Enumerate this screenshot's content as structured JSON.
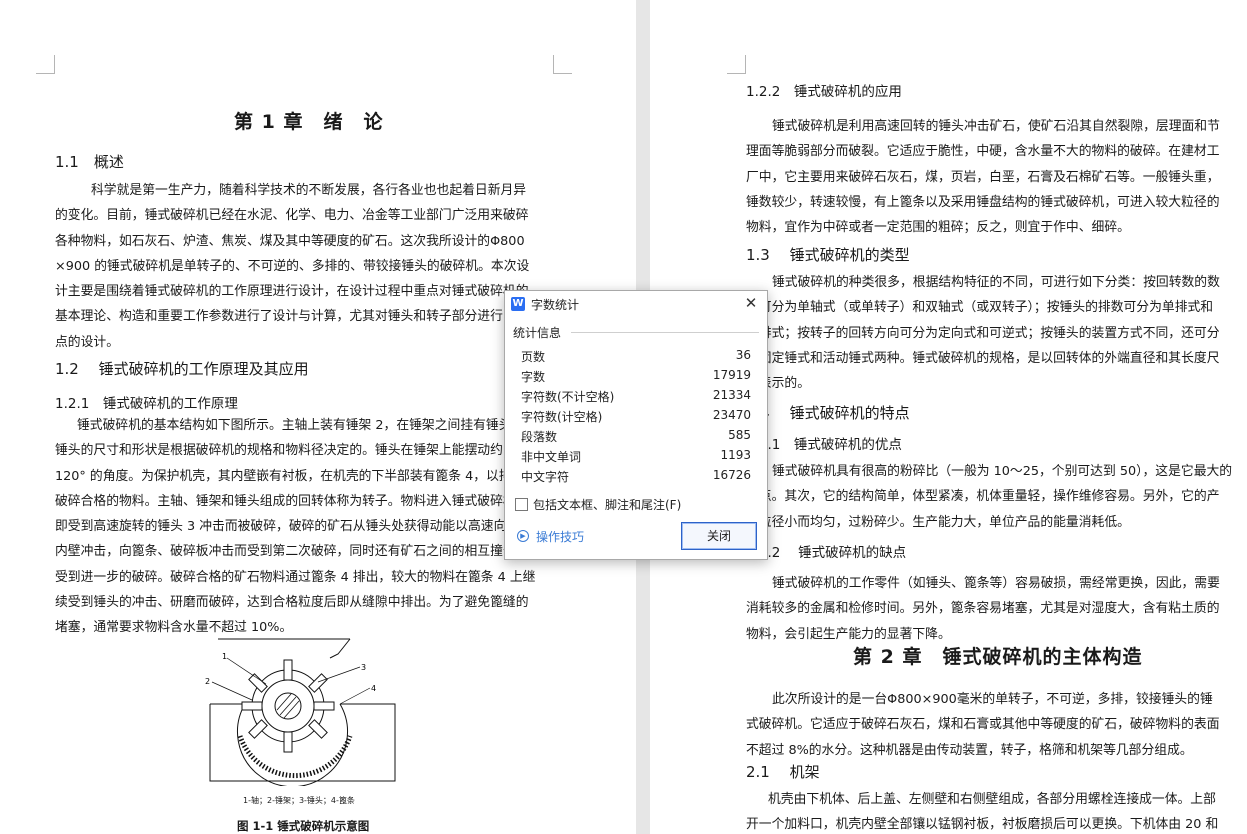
{
  "left_page": {
    "chapter_title": "第 1 章　绪　论",
    "s1_1": "1.1　概述",
    "p1": [
      "科学就是第一生产力，随着科学技术的不断发展，各行各业也也起着日新月异",
      "的变化。目前，锤式破碎机已经在水泥、化学、电力、冶金等工业部门广泛用来破碎",
      "各种物料，如石灰石、炉渣、焦炭、煤及其中等硬度的矿石。这次我所设计的Φ800",
      "×900 的锤式破碎机是单转子的、不可逆的、多排的、带铰接锤头的破碎机。本次设",
      "计主要是围绕着锤式破碎机的工作原理进行设计，在设计过程中重点对锤式破碎机的",
      "基本理论、构造和重要工作参数进行了设计与计算，尤其对锤头和转子部分进行了重",
      "点的设计。"
    ],
    "s1_2": "1.2　 锤式破碎机的工作原理及其应用",
    "s1_2_1": "1.2.1　锤式破碎机的工作原理",
    "p2": [
      "锤式破碎机的基本结构如下图所示。主轴上装有锤架 2，在锤架之间挂有锤头 1，",
      "锤头的尺寸和形状是根据破碎机的规格和物料径决定的。锤头在锤架上能摆动约",
      "120° 的角度。为保护机壳，其内壁嵌有衬板，在机壳的下半部装有篦条 4，以排出",
      "破碎合格的物料。主轴、锤架和锤头组成的回转体称为转子。物料进入锤式破碎机中，",
      "即受到高速旋转的锤头 3 冲击而被破碎，破碎的矿石从锤头处获得动能以高速向机壳",
      "内壁冲击，向篦条、破碎板冲击而受到第二次破碎，同时还有矿石之间的相互撞击，",
      "受到进一步的破碎。破碎合格的矿石物料通过篦条 4 排出，较大的物料在篦条 4 上继",
      "续受到锤头的冲击、研磨而破碎，达到合格粒度后即从缝隙中排出。为了避免篦缝的",
      "堵塞，通常要求物料含水量不超过 10%。"
    ],
    "figure": {
      "callouts": [
        "1",
        "2",
        "3",
        "4"
      ],
      "legend": "1-轴；2-锤架；3-锤头；4-篦条",
      "caption": "图 1-1  锤式破碎机示意图"
    }
  },
  "right_page": {
    "s1_2_2": "1.2.2　锤式破碎机的应用",
    "p3": [
      "锤式破碎机是利用高速回转的锤头冲击矿石，使矿石沿其自然裂隙，层理面和节",
      "理面等脆弱部分而破裂。它适应于脆性，中硬，含水量不大的物料的破碎。在建材工",
      "厂中，它主要用来破碎石灰石，煤，页岩，白垩，石膏及石棉矿石等。一般锤头重，",
      "锤数较少，转速较慢，有上篦条以及采用锤盘结构的锤式破碎机，可进入较大粒径的",
      "物料，宜作为中碎或者一定范围的粗碎；反之，则宜于作中、细碎。"
    ],
    "s1_3": "1.3　 锤式破碎机的类型",
    "p4": [
      "锤式破碎机的种类很多，根据结构特征的不同，可进行如下分类：按回转数的数",
      "目可分为单轴式（或单转子）和双轴式（或双转子）；按锤头的排数可分为单排式和",
      "多排式；按转子的回转方向可分为定向式和可逆式；按锤头的装置方式不同，还可分",
      "为固定锤式和活动锤式两种。锤式破碎机的规格，是以回转体的外端直径和其长度尺",
      "寸表示的。"
    ],
    "s1_4": "1.4　 锤式破碎机的特点",
    "s1_4_1": "1.4.1　锤式破碎机的优点",
    "p5": [
      "锤式破碎机具有很高的粉碎比（一般为 10～25，个别可达到 50），这是它最大的",
      "优点。其次，它的结构简单，体型紧凑，机体重量轻，操作维修容易。另外，它的产",
      "品粒径小而均匀，过粉碎少。生产能力大，单位产品的能量消耗低。"
    ],
    "s1_4_2": "1.4.2　 锤式破碎机的缺点",
    "p6": [
      "锤式破碎机的工作零件（如锤头、篦条等）容易破损，需经常更换，因此，需要",
      "消耗较多的金属和检修时间。另外，篦条容易堵塞，尤其是对湿度大，含有粘土质的",
      "物料，会引起生产能力的显著下降。"
    ],
    "chapter2_title": "第 2 章　锤式破碎机的主体构造",
    "p7": [
      "此次所设计的是一台Φ800×900毫米的单转子，不可逆，多排，铰接锤头的锤",
      "式破碎机。它适应于破碎石灰石，煤和石膏或其他中等硬度的矿石，破碎物料的表面",
      "不超过 8%的水分。这种机器是由传动装置，转子，格筛和机架等几部分组成。"
    ],
    "s2_1": "2.1　 机架",
    "p8": [
      "机壳由下机体、后上盖、左侧壁和右侧壁组成，各部分用螺栓连接成一体。上部",
      "开一个加料口，机壳内壁全部镶以锰钢衬板，衬板磨损后可以更换。下机体由 20 和"
    ]
  },
  "dialog": {
    "title": "字数统计",
    "section": "统计信息",
    "stats": [
      {
        "label": "页数",
        "value": "36"
      },
      {
        "label": "字数",
        "value": "17919"
      },
      {
        "label": "字符数(不计空格)",
        "value": "21334"
      },
      {
        "label": "字符数(计空格)",
        "value": "23470"
      },
      {
        "label": "段落数",
        "value": "585"
      },
      {
        "label": "非中文单词",
        "value": "1193"
      },
      {
        "label": "中文字符",
        "value": "16726"
      }
    ],
    "checkbox_label": "包括文本框、脚注和尾注(F)",
    "checkbox_checked": false,
    "tips_label": "操作技巧",
    "close_button": "关闭",
    "accent": "#2a6ef2"
  }
}
